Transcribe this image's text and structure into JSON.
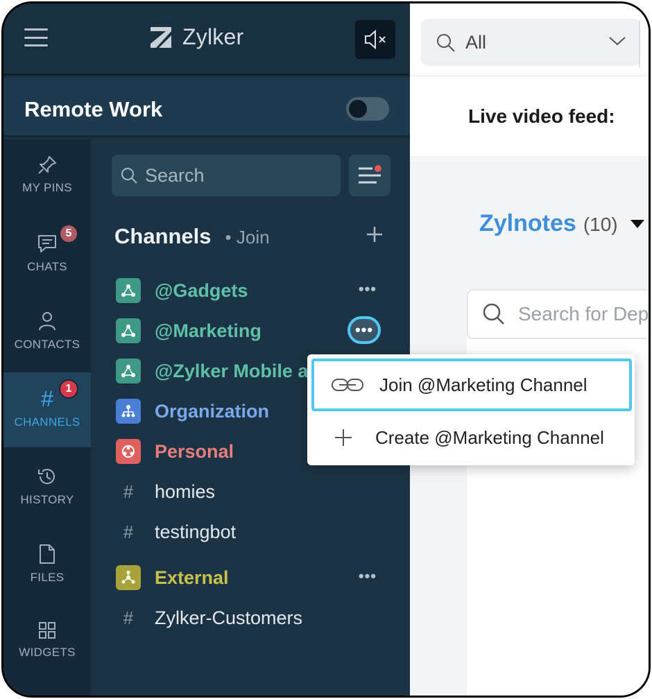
{
  "topbar": {
    "brand_name": "Zylker",
    "icons": {
      "menu": "hamburger-icon",
      "logo": "zylker-logo-icon",
      "mute": "speaker-mute-icon"
    }
  },
  "org": {
    "name": "Remote Work",
    "toggle_on": false
  },
  "rail": {
    "items": [
      {
        "label": "MY PINS",
        "icon": "pin-icon"
      },
      {
        "label": "CHATS",
        "icon": "chat-icon",
        "badge": "5"
      },
      {
        "label": "CONTACTS",
        "icon": "contact-icon"
      },
      {
        "label": "CHANNELS",
        "icon": "hash-icon",
        "badge": "1",
        "active": true
      },
      {
        "label": "HISTORY",
        "icon": "history-icon"
      },
      {
        "label": "FILES",
        "icon": "file-icon"
      },
      {
        "label": "WIDGETS",
        "icon": "widgets-icon"
      }
    ],
    "badge_colors": {
      "chats": "#b05a63",
      "channels": "#d73a4a"
    }
  },
  "panel": {
    "search_placeholder": "Search",
    "section_title": "Channels",
    "join_link": "• Join",
    "channels": [
      {
        "name": "@Gadgets",
        "kind": "team",
        "color": "#5fc0a8",
        "icon_bg": "#3e9a86"
      },
      {
        "name": "@Marketing",
        "kind": "team",
        "color": "#5fc0a8",
        "icon_bg": "#3e9a86"
      },
      {
        "name": "@Zylker Mobile app",
        "kind": "team",
        "color": "#5fc0a8",
        "icon_bg": "#3e9a86"
      },
      {
        "name": "Organization",
        "kind": "org",
        "color": "#79a9ea",
        "icon_bg": "#4a7fd6"
      },
      {
        "name": "Personal",
        "kind": "personal",
        "color": "#e87d7d",
        "icon_bg": "#e05f5f"
      },
      {
        "name": "homies",
        "kind": "hash",
        "color": "#e4e9ed"
      },
      {
        "name": "testingbot",
        "kind": "hash",
        "color": "#e4e9ed"
      },
      {
        "name": "External",
        "kind": "external",
        "color": "#c8c24a",
        "icon_bg": "#a9a33b"
      },
      {
        "name": "Zylker-Customers",
        "kind": "hash",
        "color": "#e4e9ed"
      }
    ]
  },
  "right": {
    "scope_select": "All",
    "live_label": "Live video feed:",
    "notes_title": "Zylnotes",
    "notes_count": "(10)",
    "dep_search_placeholder": "Search for Dep"
  },
  "menu": {
    "items": [
      {
        "label": "Join @Marketing Channel",
        "icon": "link-icon"
      },
      {
        "label": "Create @Marketing Channel",
        "icon": "plus-icon"
      }
    ]
  }
}
